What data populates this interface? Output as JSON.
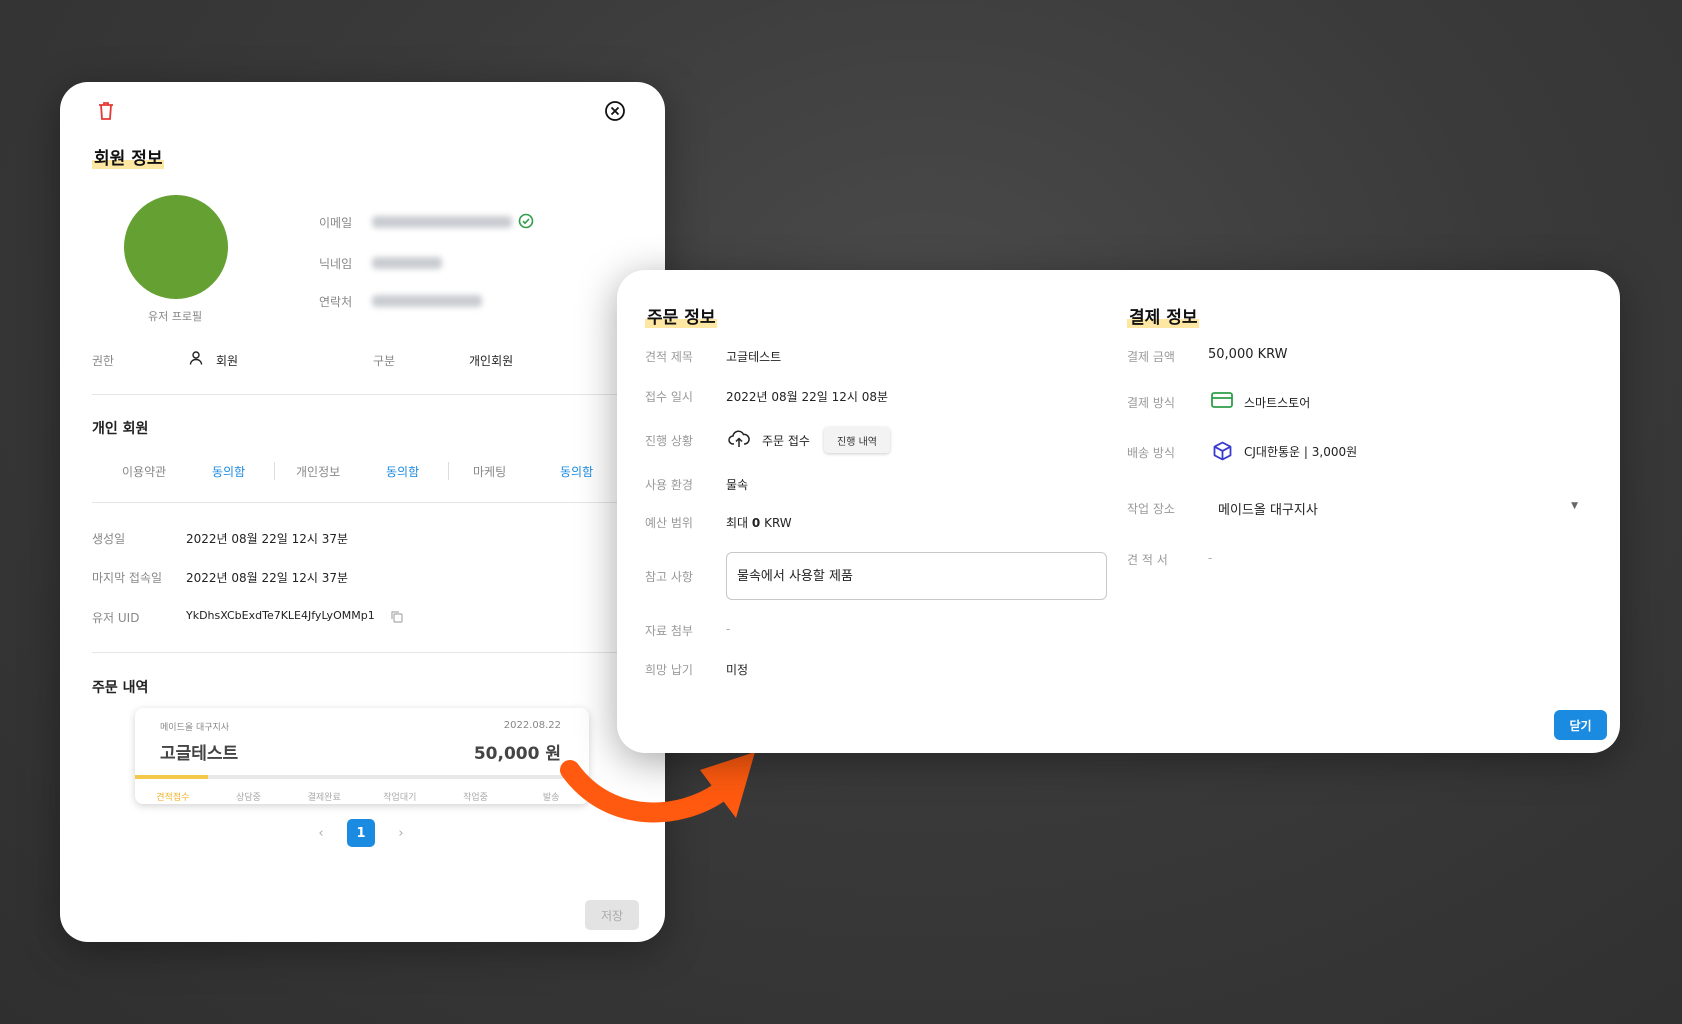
{
  "member": {
    "title": "회원 정보",
    "profile_caption": "유저 프로필",
    "email_label": "이메일",
    "nickname_label": "닉네임",
    "contact_label": "연락처",
    "role_label": "권한",
    "role_value": "회원",
    "type_label": "구분",
    "type_value": "개인회원",
    "section_personal": "개인 회원",
    "consents": [
      {
        "label": "이용약관",
        "status": "동의함"
      },
      {
        "label": "개인정보",
        "status": "동의함"
      },
      {
        "label": "마케팅",
        "status": "동의함"
      }
    ],
    "created_label": "생성일",
    "created_value": "2022년 08월 22일 12시 37분",
    "last_login_label": "마지막 접속일",
    "last_login_value": "2022년 08월 22일 12시 37분",
    "uid_label": "유저 UID",
    "uid_value": "YkDhsXCbExdTe7KLE4JfyLyOMMp1",
    "orders_title": "주문 내역",
    "order_card": {
      "workshop": "메이드올 대구지사",
      "date": "2022.08.22",
      "name": "고글테스트",
      "amount": "50,000 원",
      "progress": 0.16,
      "steps": [
        "견적접수",
        "상담중",
        "결제완료",
        "작업대기",
        "작업중",
        "발송"
      ]
    },
    "pagination": {
      "prev": "‹",
      "current": "1",
      "next": "›"
    },
    "save_label": "저장",
    "colors": {
      "avatar": "#65a033",
      "verified": "#2e9e48",
      "delete": "#e53935"
    }
  },
  "order": {
    "title": "주문 정보",
    "rows": {
      "subject_label": "견적 제목",
      "subject_value": "고글테스트",
      "received_label": "접수 일시",
      "received_value": "2022년 08월 22일 12시 08분",
      "status_label": "진행 상황",
      "status_value": "주문 접수",
      "history_button": "진행 내역",
      "env_label": "사용 환경",
      "env_value": "물속",
      "budget_label": "예산 범위",
      "budget_prefix": "최대 ",
      "budget_amount": "0",
      "budget_unit": " KRW",
      "notes_label": "참고 사항",
      "notes_value": "물속에서 사용할 제품",
      "attach_label": "자료 첨부",
      "attach_value": "-",
      "due_label": "희망 납기",
      "due_value": "미정"
    }
  },
  "payment": {
    "title": "결제 정보",
    "amount_label": "결제 금액",
    "amount_value": "50,000 KRW",
    "method_label": "결제 방식",
    "method_value": "스마트스토어",
    "shipping_label": "배송 방식",
    "shipping_value": "CJ대한통운 | 3,000원",
    "workshop_label": "작업 장소",
    "workshop_value": "메이드올 대구지사",
    "estimate_label": "견 적 서",
    "estimate_value": "-",
    "close_label": "닫기"
  }
}
